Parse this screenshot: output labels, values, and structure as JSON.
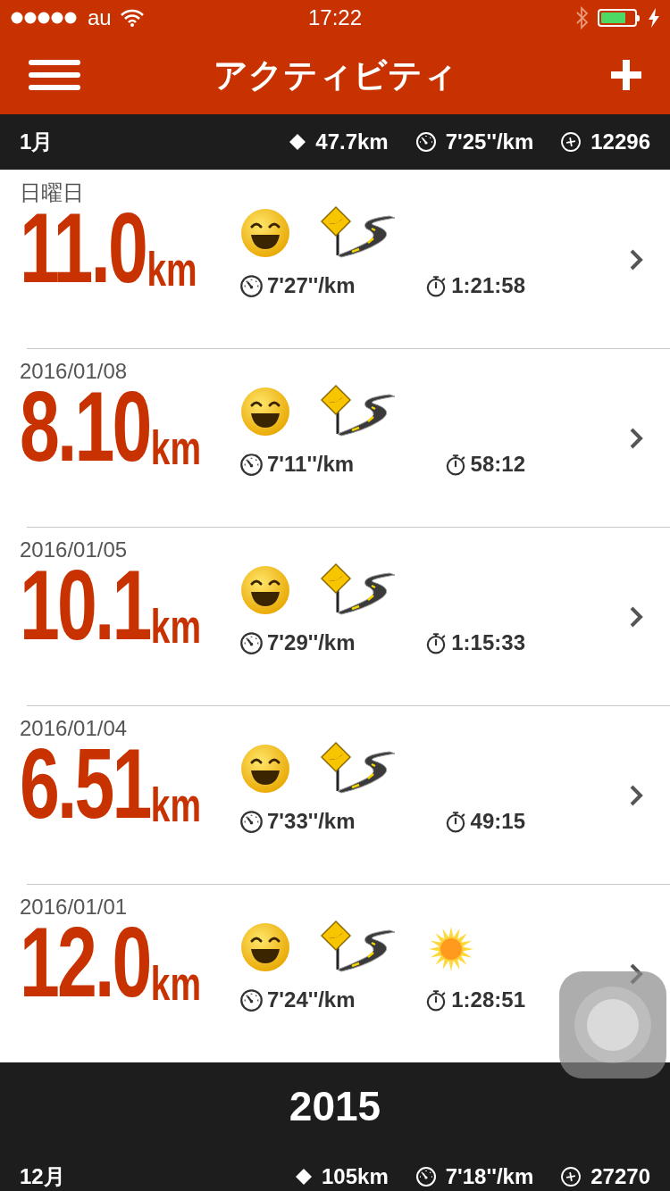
{
  "status_bar": {
    "carrier": "au",
    "time": "17:22"
  },
  "header": {
    "title": "アクティビティ"
  },
  "months": [
    {
      "label": "1月",
      "distance": "47.7km",
      "pace": "7'25''/km",
      "fuel": "12296"
    }
  ],
  "activities": [
    {
      "date": "日曜日",
      "distance": "11.0",
      "unit": "km",
      "pace": "7'27''/km",
      "duration": "1:21:58",
      "icons": [
        {
          "kind": "smile"
        },
        {
          "kind": "road"
        }
      ]
    },
    {
      "date": "2016/01/08",
      "distance": "8.10",
      "unit": "km",
      "pace": "7'11''/km",
      "duration": "58:12",
      "icons": [
        {
          "kind": "smile"
        },
        {
          "kind": "road"
        }
      ]
    },
    {
      "date": "2016/01/05",
      "distance": "10.1",
      "unit": "km",
      "pace": "7'29''/km",
      "duration": "1:15:33",
      "icons": [
        {
          "kind": "smile"
        },
        {
          "kind": "road"
        }
      ]
    },
    {
      "date": "2016/01/04",
      "distance": "6.51",
      "unit": "km",
      "pace": "7'33''/km",
      "duration": "49:15",
      "icons": [
        {
          "kind": "smile"
        },
        {
          "kind": "road"
        }
      ]
    },
    {
      "date": "2016/01/01",
      "distance": "12.0",
      "unit": "km",
      "pace": "7'24''/km",
      "duration": "1:28:51",
      "icons": [
        {
          "kind": "smile"
        },
        {
          "kind": "road"
        },
        {
          "kind": "sun"
        }
      ]
    }
  ],
  "year_header": "2015",
  "next_month": {
    "label": "12月",
    "distance": "105km",
    "pace": "7'18''/km",
    "fuel": "27270"
  }
}
